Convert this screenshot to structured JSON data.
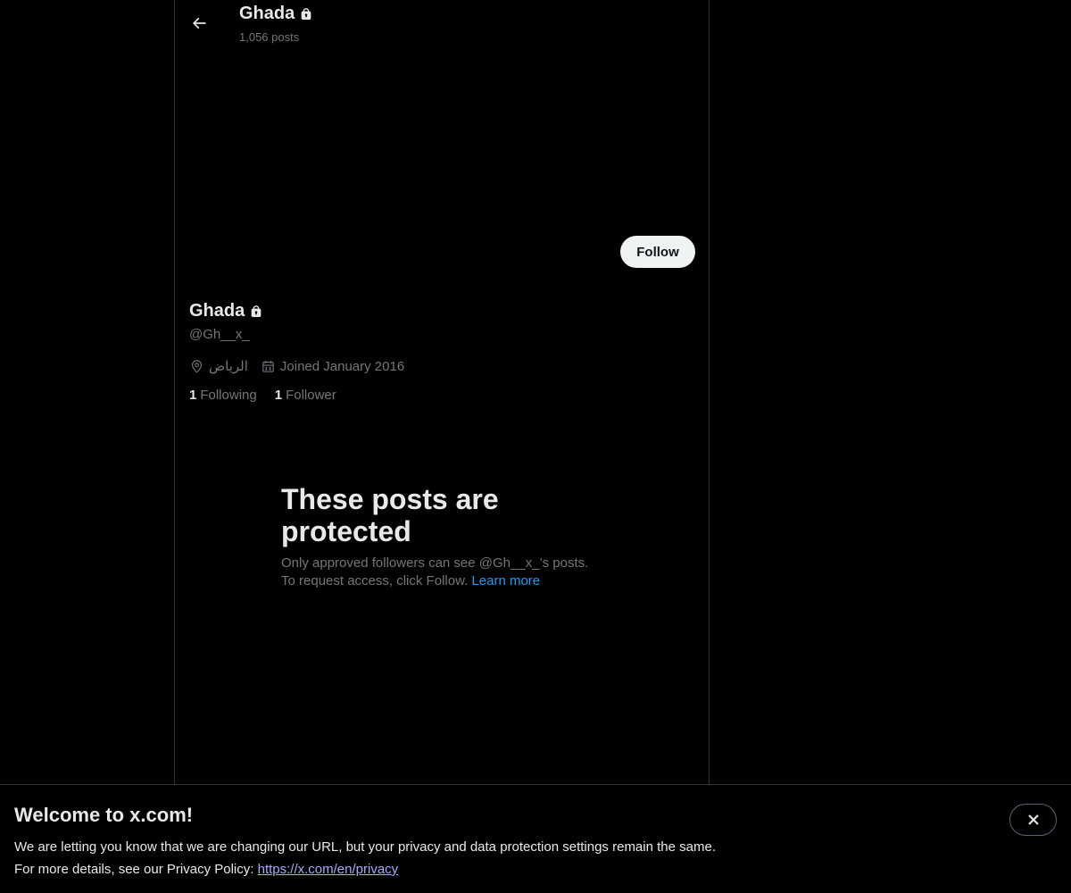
{
  "header": {
    "name": "Ghada",
    "post_count": "1,056 posts"
  },
  "profile": {
    "follow_label": "Follow",
    "name": "Ghada",
    "handle": "@Gh__x_",
    "location": "الرياض",
    "joined": "Joined January 2016",
    "following_count": "1",
    "following_label": "Following",
    "follower_count": "1",
    "follower_label": "Follower"
  },
  "protected": {
    "title": "These posts are protected",
    "desc_line1": "Only approved followers can see @Gh__x_’s posts.",
    "desc_line2": "To request access, click Follow.",
    "learn_more": "Learn more"
  },
  "banner": {
    "title": "Welcome to x.com!",
    "line1": "We are letting you know that we are changing our URL, but your privacy and data protection settings remain the same.",
    "line2": "For more details, see our Privacy Policy:",
    "link": "https://x.com/en/privacy"
  },
  "icons": {
    "back": "arrow-left-icon",
    "lock": "lock-icon",
    "location": "location-pin-icon",
    "calendar": "calendar-icon",
    "close": "close-icon"
  },
  "colors": {
    "background": "#000000",
    "text": "#e7e9ea",
    "secondary_text": "#71767b",
    "link": "#1d9bf0",
    "follow_button": "#eff3f4"
  }
}
